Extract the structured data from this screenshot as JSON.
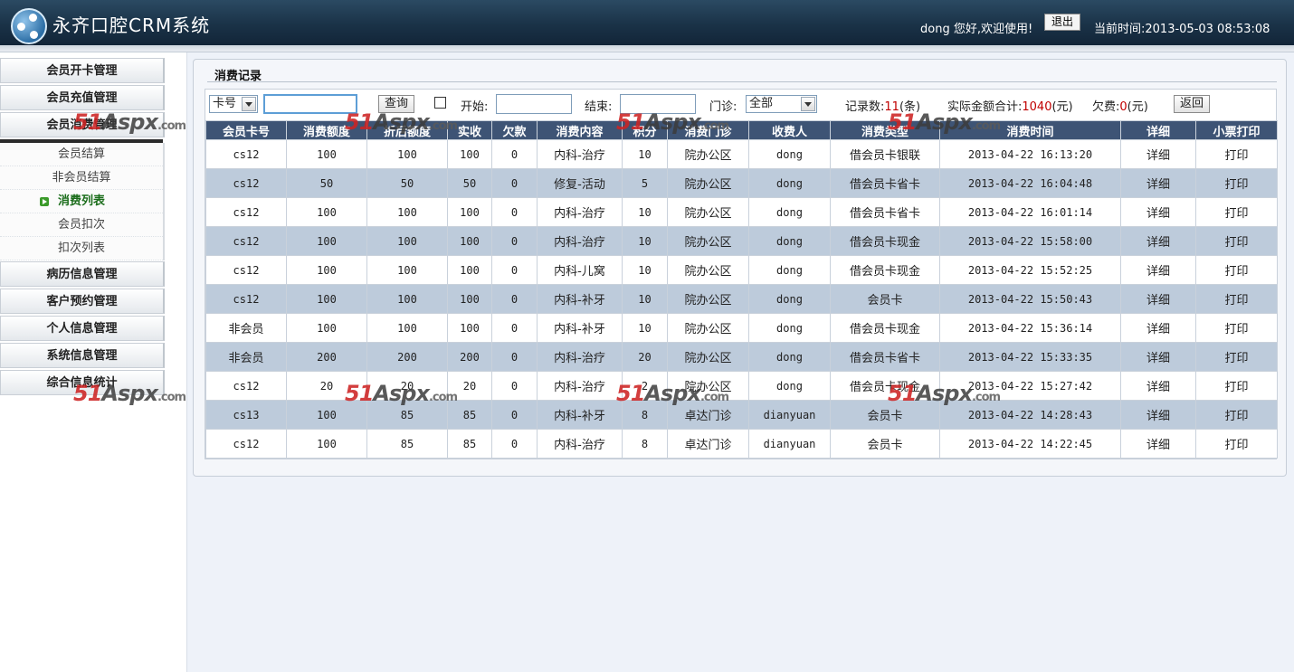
{
  "header": {
    "title": "永齐口腔CRM系统",
    "greeting": "dong 您好,欢迎使用!",
    "logout_label": "退出",
    "time_label": "当前时间:2013-05-03 08:53:08"
  },
  "sidebar": {
    "menus": [
      "会员开卡管理",
      "会员充值管理",
      "会员消费管理",
      "病历信息管理",
      "客户预约管理",
      "个人信息管理",
      "系统信息管理",
      "综合信息统计"
    ],
    "subitems": [
      "会员结算",
      "非会员结算",
      "消费列表",
      "会员扣次",
      "扣次列表"
    ],
    "active_subitem": "消费列表"
  },
  "panel": {
    "title": "消费记录"
  },
  "toolbar": {
    "search_type": "卡号",
    "search_value": "",
    "query_label": "查询",
    "start_label": "开始:",
    "end_label": "结束:",
    "clinic_label": "门诊:",
    "clinic_value": "全部",
    "count_prefix": "记录数:",
    "count_value": "11",
    "count_suffix": "(条)",
    "amount_prefix": "实际金额合计:",
    "amount_value": "1040",
    "amount_suffix": "(元)",
    "debt_prefix": "欠费:",
    "debt_value": "0",
    "debt_suffix": "(元)",
    "back_label": "返回"
  },
  "table": {
    "headers": [
      "会员卡号",
      "消费额度",
      "折后额度",
      "实收",
      "欠款",
      "消费内容",
      "积分",
      "消费门诊",
      "收费人",
      "消费类型",
      "消费时间",
      "详细",
      "小票打印"
    ],
    "rows": [
      [
        "cs12",
        "100",
        "100",
        "100",
        "0",
        "内科-治疗",
        "10",
        "院办公区",
        "dong",
        "借会员卡银联",
        "2013-04-22 16:13:20",
        "详细",
        "打印"
      ],
      [
        "cs12",
        "50",
        "50",
        "50",
        "0",
        "修复-活动",
        "5",
        "院办公区",
        "dong",
        "借会员卡省卡",
        "2013-04-22 16:04:48",
        "详细",
        "打印"
      ],
      [
        "cs12",
        "100",
        "100",
        "100",
        "0",
        "内科-治疗",
        "10",
        "院办公区",
        "dong",
        "借会员卡省卡",
        "2013-04-22 16:01:14",
        "详细",
        "打印"
      ],
      [
        "cs12",
        "100",
        "100",
        "100",
        "0",
        "内科-治疗",
        "10",
        "院办公区",
        "dong",
        "借会员卡现金",
        "2013-04-22 15:58:00",
        "详细",
        "打印"
      ],
      [
        "cs12",
        "100",
        "100",
        "100",
        "0",
        "内科-儿窝",
        "10",
        "院办公区",
        "dong",
        "借会员卡现金",
        "2013-04-22 15:52:25",
        "详细",
        "打印"
      ],
      [
        "cs12",
        "100",
        "100",
        "100",
        "0",
        "内科-补牙",
        "10",
        "院办公区",
        "dong",
        "会员卡",
        "2013-04-22 15:50:43",
        "详细",
        "打印"
      ],
      [
        "非会员",
        "100",
        "100",
        "100",
        "0",
        "内科-补牙",
        "10",
        "院办公区",
        "dong",
        "借会员卡现金",
        "2013-04-22 15:36:14",
        "详细",
        "打印"
      ],
      [
        "非会员",
        "200",
        "200",
        "200",
        "0",
        "内科-治疗",
        "20",
        "院办公区",
        "dong",
        "借会员卡省卡",
        "2013-04-22 15:33:35",
        "详细",
        "打印"
      ],
      [
        "cs12",
        "20",
        "20",
        "20",
        "0",
        "内科-治疗",
        "2",
        "院办公区",
        "dong",
        "借会员卡现金",
        "2013-04-22 15:27:42",
        "详细",
        "打印"
      ],
      [
        "cs13",
        "100",
        "85",
        "85",
        "0",
        "内科-补牙",
        "8",
        "卓达门诊",
        "dianyuan",
        "会员卡",
        "2013-04-22 14:28:43",
        "详细",
        "打印"
      ],
      [
        "cs12",
        "100",
        "85",
        "85",
        "0",
        "内科-治疗",
        "8",
        "卓达门诊",
        "dianyuan",
        "会员卡",
        "2013-04-22 14:22:45",
        "详细",
        "打印"
      ]
    ]
  },
  "watermark": {
    "main": "51",
    "mid": "Aspx",
    "tld": ".com"
  }
}
